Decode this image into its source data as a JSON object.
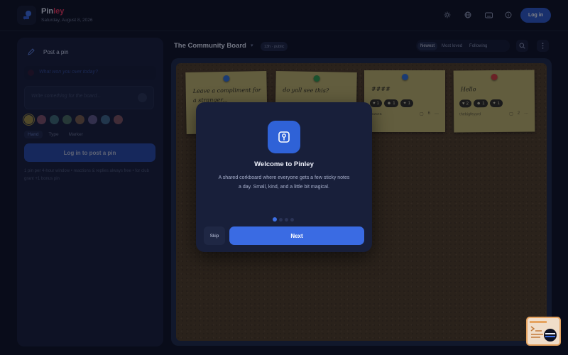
{
  "app": {
    "brand_part1": "Pin",
    "brand_part2": "ley",
    "date": "Saturday, August 8, 2026",
    "login_label": "Log in",
    "header_icons": [
      "sun-icon",
      "globe-icon",
      "keyboard-icon",
      "info-icon"
    ]
  },
  "composer": {
    "title": "Post a pin",
    "prompt": "What won you over today?",
    "placeholder": "Write something for the board...",
    "colors": [
      "#c9b046",
      "#d6798e",
      "#5fa8a3",
      "#6fa77a",
      "#c88e55",
      "#9c86c9",
      "#5e9ec9",
      "#d47c7c"
    ],
    "fonts": [
      "Hand",
      "Type",
      "Marker"
    ],
    "selected_font": "Hand",
    "post_button": "Log in to post a pin",
    "note": "1 pin per 4-hour window • reactions & replies always free • for club grant +1 bonus pin"
  },
  "board": {
    "title": "The Community Board",
    "badge": "13h · public",
    "sort_tabs": [
      "Newest",
      "Most loved",
      "Following"
    ],
    "selected_sort": "Newest",
    "notes": [
      {
        "text": "Leave a compliment for a stranger...",
        "pin_color": "#2f6fd6",
        "reactions": [],
        "author": "",
        "replies": ""
      },
      {
        "text": "do yall see this?",
        "pin_color": "#2e9a4a",
        "reactions": [],
        "author": "",
        "replies": ""
      },
      {
        "text": "####",
        "pin_color": "#2f6fd6",
        "reactions": [
          {
            "icon": "heart-icon",
            "count": "1"
          },
          {
            "icon": "smile-icon",
            "count": "1"
          },
          {
            "icon": "sparkle-icon",
            "count": "1"
          }
        ],
        "author": "yuzura",
        "replies": "6"
      },
      {
        "text": "Hello",
        "pin_color": "#d03a3a",
        "reactions": [
          {
            "icon": "heart-icon",
            "count": "2"
          },
          {
            "icon": "smile-icon",
            "count": "1"
          },
          {
            "icon": "sparkle-icon",
            "count": "1"
          }
        ],
        "author": "thebigfeyyrd",
        "replies": "2"
      }
    ]
  },
  "modal": {
    "title": "Welcome to Pinley",
    "body": "A shared corkboard where everyone gets a few sticky notes a day. Small, kind, and a little bit magical.",
    "skip_label": "Skip",
    "next_label": "Next",
    "step_current": 1,
    "step_total": 4
  }
}
